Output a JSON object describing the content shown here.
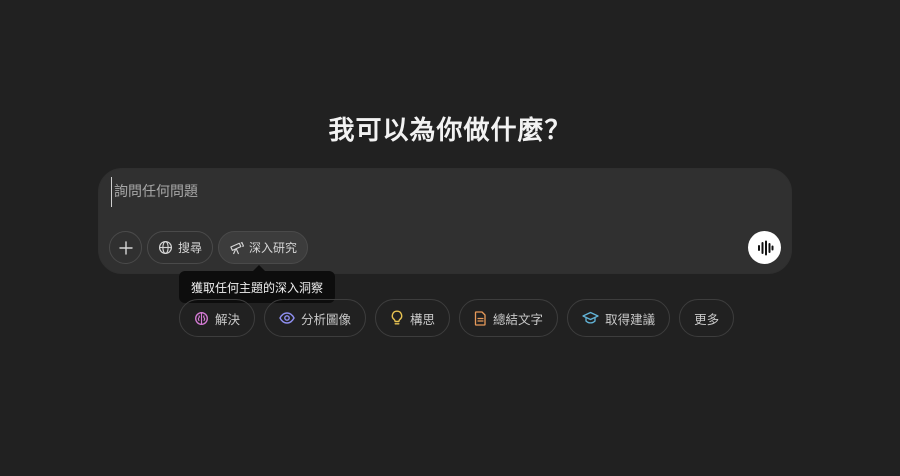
{
  "heading": "我可以為你做什麼？",
  "composer": {
    "placeholder": "詢問任何問題",
    "add_icon": "plus-icon",
    "search_label": "搜尋",
    "search_icon": "globe-icon",
    "research_label": "深入研究",
    "research_icon": "telescope-icon",
    "voice_icon": "voice-waveform-icon"
  },
  "tooltip": "獲取任何主題的深入洞察",
  "suggestions": [
    {
      "label": "解決",
      "icon": "brain-icon",
      "color": "#d67bd6"
    },
    {
      "label": "分析圖像",
      "icon": "eye-icon",
      "color": "#8f8ff0"
    },
    {
      "label": "構思",
      "icon": "lightbulb-icon",
      "color": "#e8c352"
    },
    {
      "label": "總結文字",
      "icon": "document-icon",
      "color": "#e89a5a"
    },
    {
      "label": "取得建議",
      "icon": "graduation-cap-icon",
      "color": "#62b4d8"
    },
    {
      "label": "更多",
      "icon": "",
      "color": ""
    }
  ]
}
